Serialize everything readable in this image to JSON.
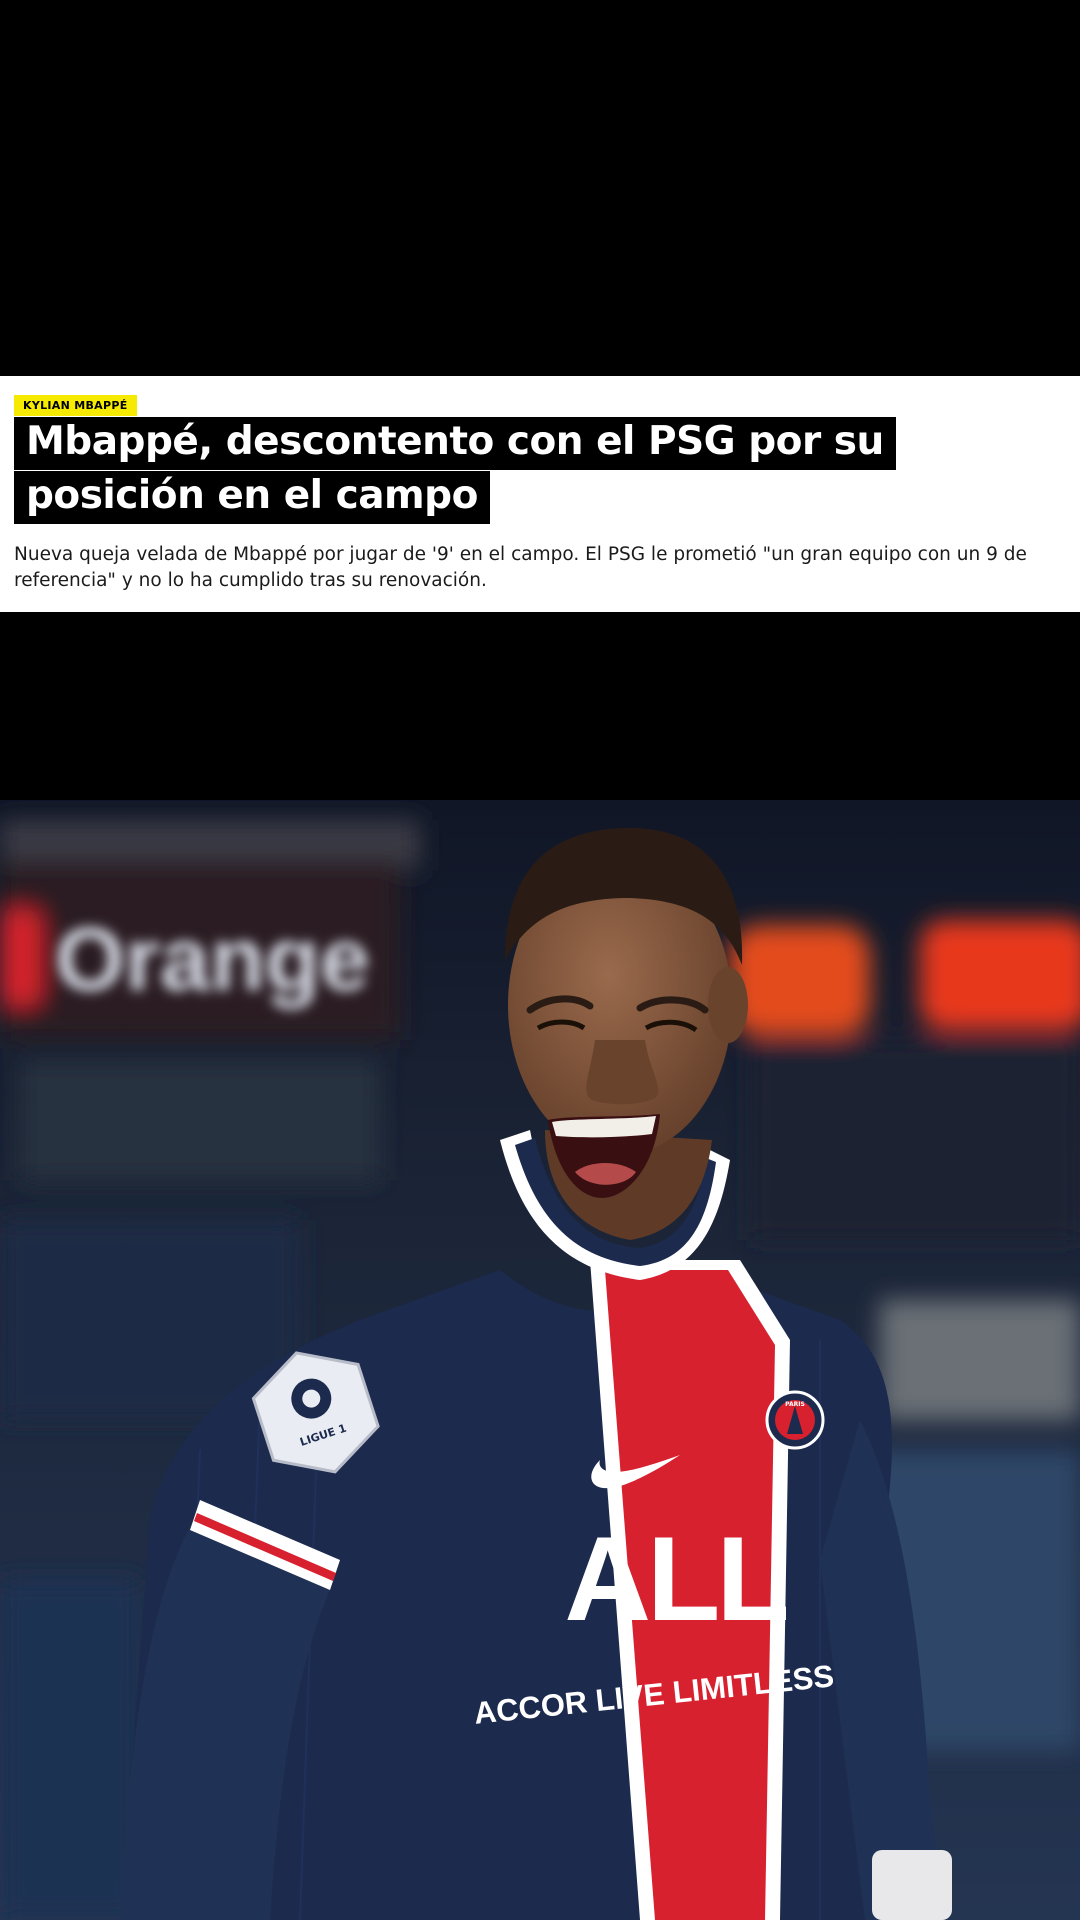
{
  "article": {
    "tag": "KYLIAN MBAPPÉ",
    "headline": "Mbappé, descontento con el PSG por su posición en el campo",
    "summary": "Nueva queja velada de Mbappé por jugar de '9' en el campo. El PSG le prometió \"un gran equipo con un 9 de referencia\" y no lo ha cumplido tras su renovación."
  },
  "photo": {
    "jersey_sponsor_line1": "ALL",
    "jersey_sponsor_line2": "ACCOR LIVE LIMITLESS",
    "crest_text": "PARIS",
    "badge_text": "LIGUE 1",
    "stadium_board_text": "Orange"
  },
  "colors": {
    "tag_background": "#f5ea00",
    "headline_background": "#000000",
    "jersey_navy": "#1c2a4e",
    "jersey_red": "#d8212f"
  }
}
